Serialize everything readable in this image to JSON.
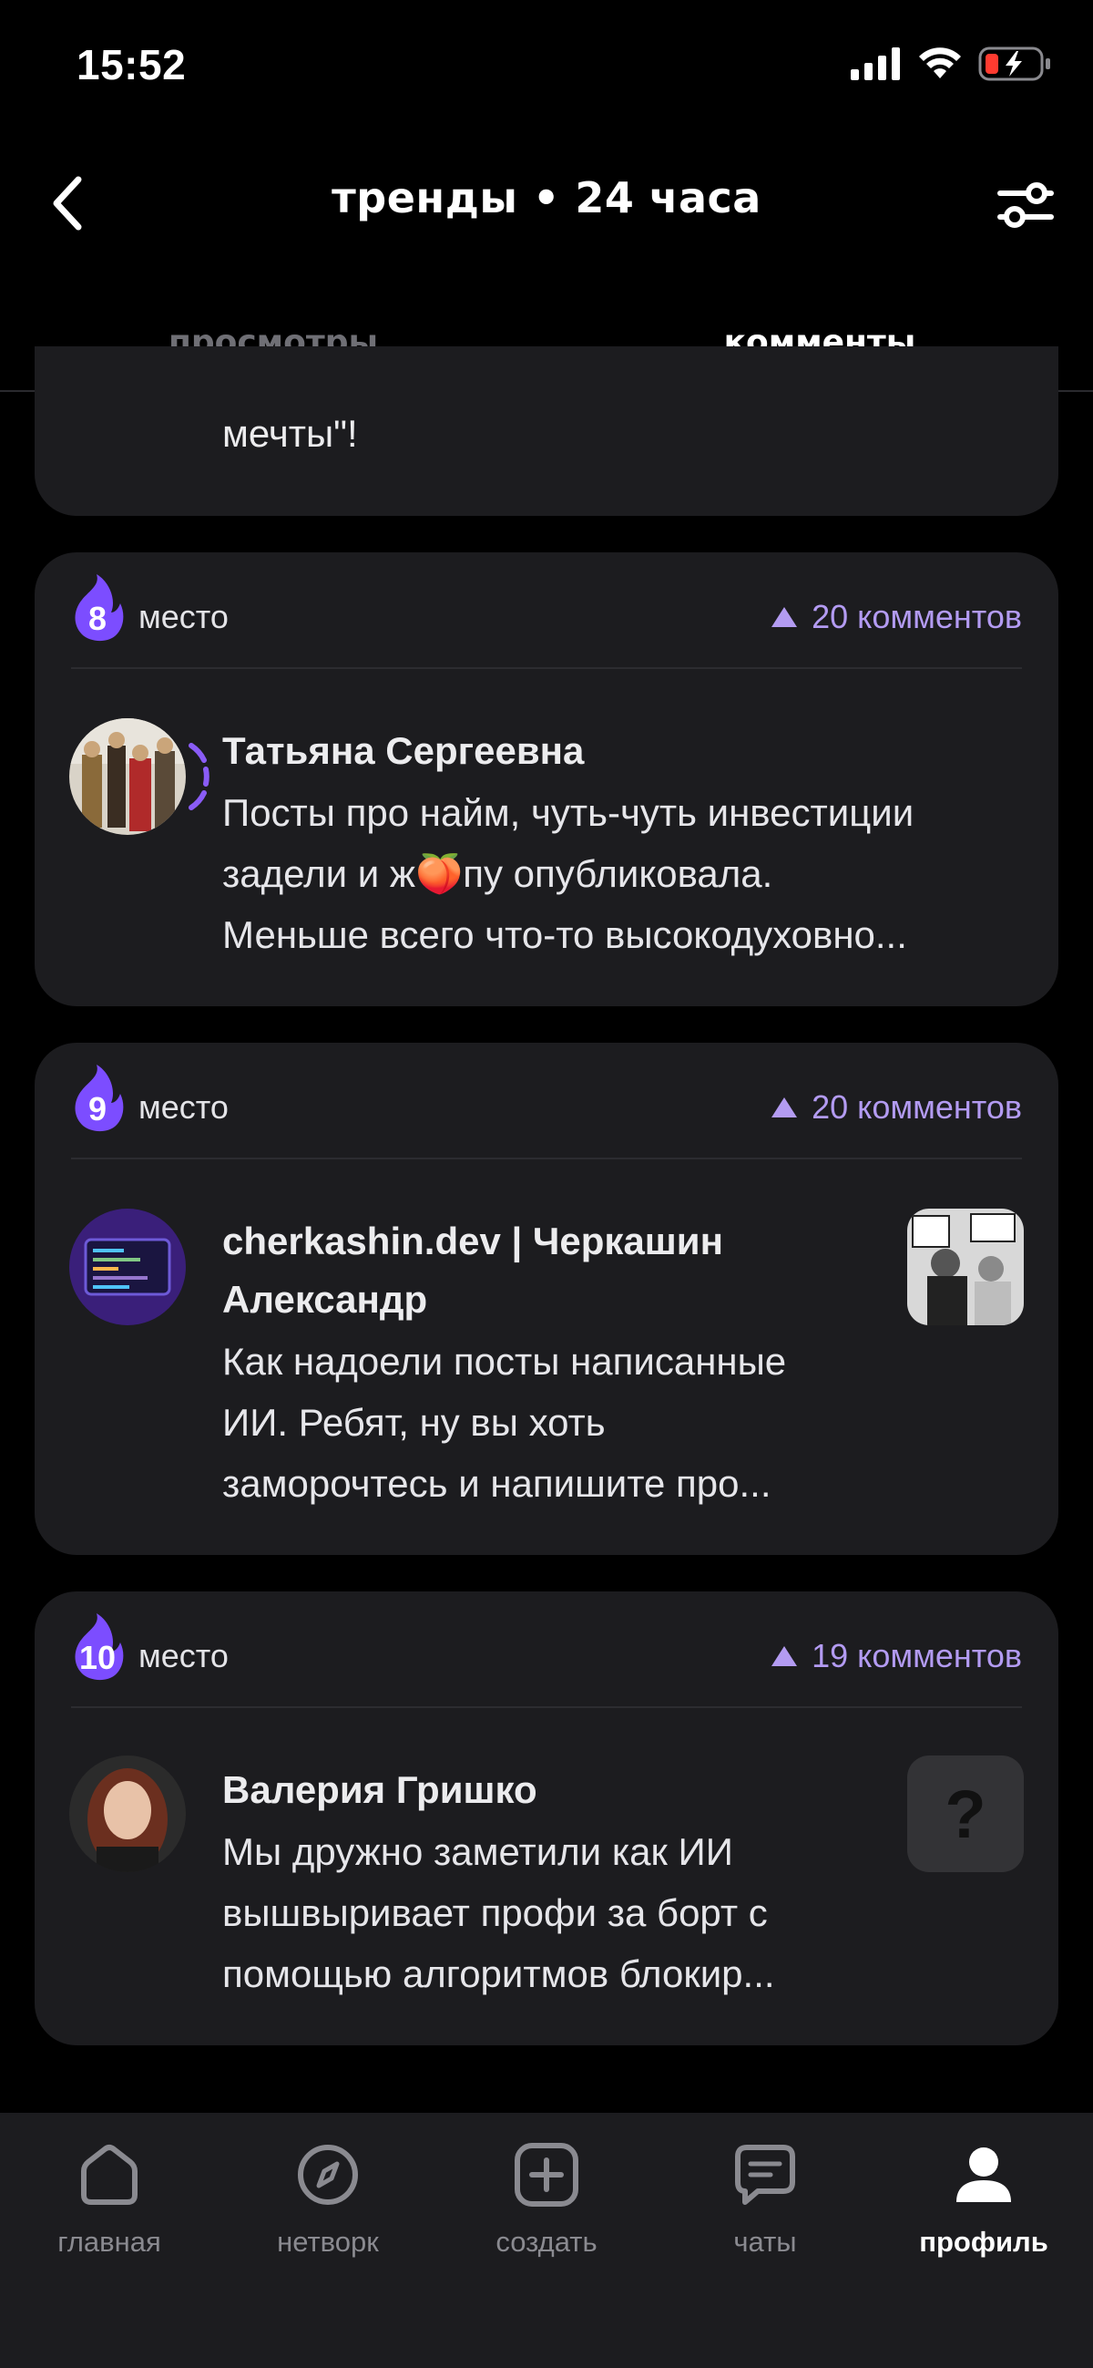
{
  "status": {
    "time": "15:52"
  },
  "header": {
    "title": "тренды • 24 часа"
  },
  "tabs": [
    {
      "label": "просмотры",
      "active": false
    },
    {
      "label": "комменты",
      "active": true
    }
  ],
  "partial_card": {
    "text": "мечты\"!"
  },
  "cards": [
    {
      "rank": "8",
      "rank_label": "место",
      "comments": "20 комментов",
      "author": "Татьяна Сергеевна",
      "text_lines": [
        "Посты про найм, чуть-чуть инвестиции",
        "задели и ж🍑пу опубликовала.",
        "Меньше всего что-то высокодуховно..."
      ]
    },
    {
      "rank": "9",
      "rank_label": "место",
      "comments": "20 комментов",
      "author_lines": [
        "cherkashin.dev | Черкашин",
        "Александр"
      ],
      "text_lines": [
        "Как надоели посты написанные",
        "ИИ. Ребят, ну вы хоть",
        "заморочтесь и напишите про..."
      ]
    },
    {
      "rank": "10",
      "rank_label": "место",
      "comments": "19 комментов",
      "author": "Валерия Гришко",
      "text_lines": [
        "Мы дружно заметили как ИИ",
        "вышвыривает профи за борт с",
        "помощью алгоритмов блокир..."
      ],
      "thumb_icon": "?"
    }
  ],
  "nav": [
    {
      "label": "главная",
      "icon": "home-icon"
    },
    {
      "label": "нетворк",
      "icon": "compass-icon"
    },
    {
      "label": "создать",
      "icon": "plus-square-icon"
    },
    {
      "label": "чаты",
      "icon": "chat-icon"
    },
    {
      "label": "профиль",
      "icon": "profile-icon",
      "active": true
    }
  ],
  "colors": {
    "accent": "#b39bf2",
    "flame": "#7c4dff",
    "card": "#1c1c1f"
  }
}
